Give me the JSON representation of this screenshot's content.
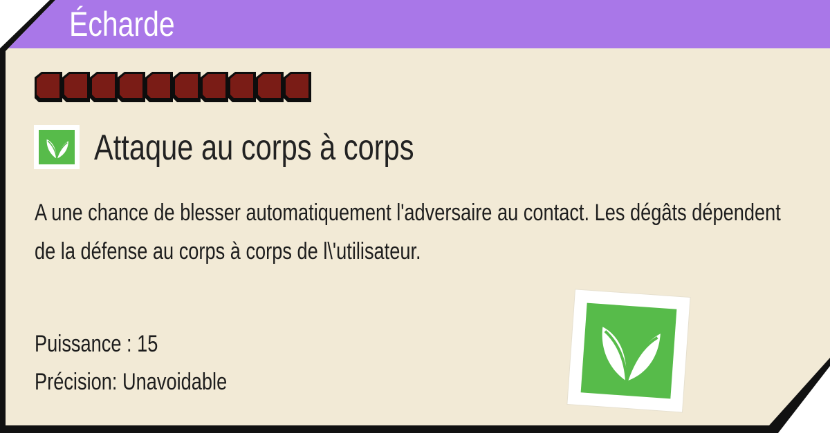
{
  "move": {
    "name": "Écharde",
    "category_label": "Attaque au corps à corps",
    "description": "A une chance de blesser automatiquement l'adversaire au contact. Les dégâts dépendent de la défense au corps à corps de l\\'utilisateur.",
    "power_line": "Puissance : 15",
    "accuracy_line": "Précision: Unavoidable",
    "pp_pips": 10,
    "type_icon": "grass-leaf-icon"
  },
  "colors": {
    "title_bar": "#a977e8",
    "card_bg": "#f2ead6",
    "pip_fill": "#7a1c16",
    "type_green": "#57bb4a"
  }
}
